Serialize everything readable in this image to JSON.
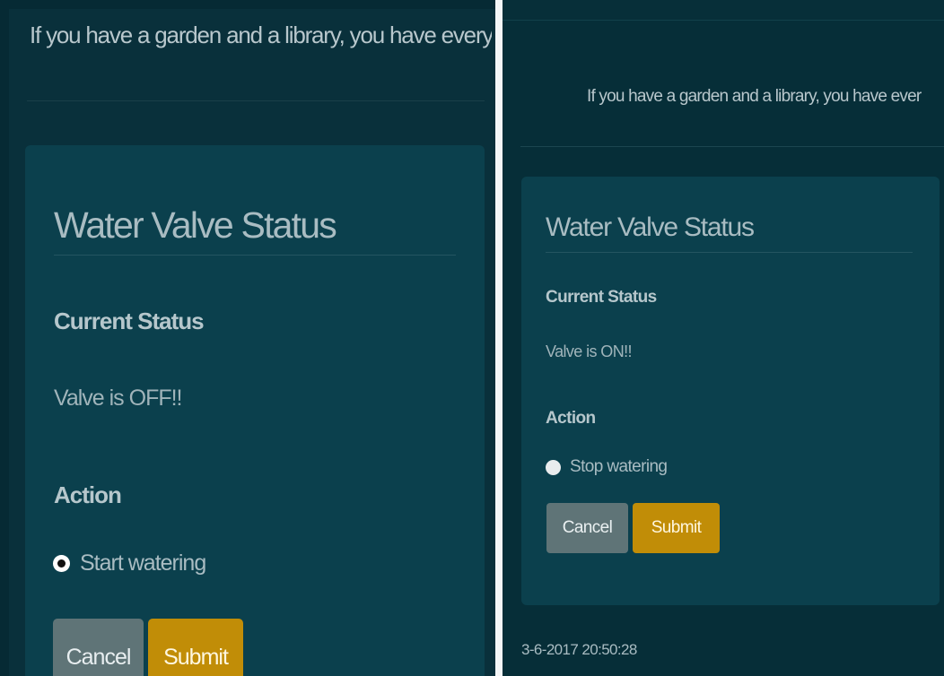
{
  "left_screen": {
    "quote": "If you have a garden and a library, you have everything t",
    "card": {
      "title": "Water Valve Status",
      "current_status_label": "Current Status",
      "status_text": "Valve is OFF!!",
      "action_label": "Action",
      "option_label": "Start watering",
      "option_selected": true,
      "cancel_label": "Cancel",
      "submit_label": "Submit"
    }
  },
  "right_screen": {
    "quote": "If you have a garden and a library, you have ever",
    "card": {
      "title": "Water Valve Status",
      "current_status_label": "Current Status",
      "status_text": "Valve is ON!!",
      "action_label": "Action",
      "option_label": "Stop watering",
      "option_selected": false,
      "cancel_label": "Cancel",
      "submit_label": "Submit"
    },
    "timestamp": "3-6-2017 20:50:28"
  },
  "colors": {
    "page_background": "#062a34",
    "card_background": "#0b404d",
    "cancel_button": "#5f7477",
    "submit_button": "#c18d07",
    "text": "#a9bcc2"
  }
}
